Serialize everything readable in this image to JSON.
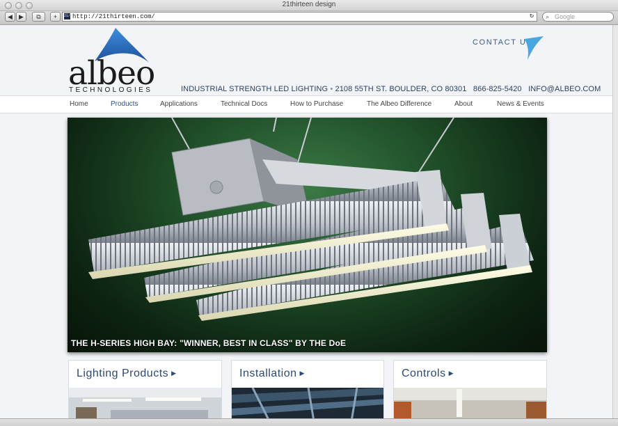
{
  "window": {
    "title": "21thirteen design",
    "url": "http://21thirteen.com/",
    "favicon_text": "21/13",
    "search_placeholder": "Google",
    "nav_glyphs": {
      "back": "◀",
      "forward": "▶",
      "bookmarks": "⧉",
      "add": "+",
      "reload": "↻",
      "search": "⌕"
    }
  },
  "header": {
    "logo_word": "albeo",
    "logo_sub": "TECHNOLOGIES",
    "contact_label": "CONTACT US",
    "tagline": "INDUSTRIAL STRENGTH LED LIGHTING",
    "separator": "•",
    "address": "2108 55TH ST. BOULDER, CO 80301",
    "phone": "866-825-5420",
    "email": "INFO@ALBEO.COM"
  },
  "nav": {
    "items": [
      {
        "label": "Home"
      },
      {
        "label": "Products"
      },
      {
        "label": "Applications"
      },
      {
        "label": "Technical Docs"
      },
      {
        "label": "How to Purchase"
      },
      {
        "label": "The Albeo Difference"
      },
      {
        "label": "About"
      },
      {
        "label": "News & Events"
      }
    ],
    "active": "Products"
  },
  "hero": {
    "caption": "THE H-SERIES HIGH BAY: \"WINNER, BEST IN CLASS\" BY THE DoE"
  },
  "cards": [
    {
      "title": "Lighting Products",
      "arrow": "▶"
    },
    {
      "title": "Installation",
      "arrow": "▶"
    },
    {
      "title": "Controls",
      "arrow": "▶"
    }
  ],
  "colors": {
    "brand_blue": "#2c4a74",
    "logo_blue": "#3a7fd0",
    "hero_green": "#1f4d28"
  }
}
